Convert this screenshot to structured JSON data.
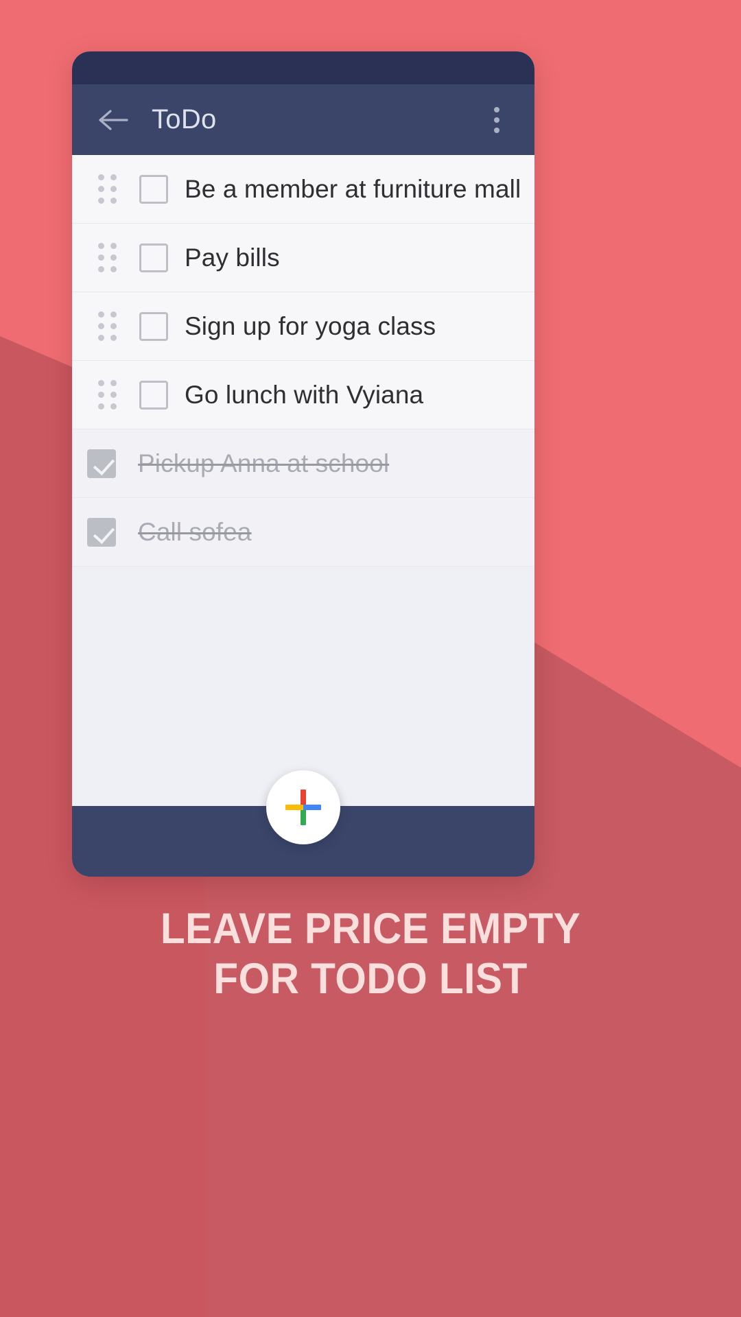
{
  "promo": {
    "background_color": "#ef6d72",
    "background_color_dark": "#c75a62",
    "caption_line1": "LEAVE PRICE EMPTY",
    "caption_line2": "FOR TODO LIST",
    "caption_color": "#fadfdd"
  },
  "app": {
    "statusbar_color": "#2b3155",
    "toolbar_color": "#3a4569",
    "toolbar": {
      "title": "ToDo",
      "back_icon": "arrow-left-icon",
      "overflow_icon": "more-vertical-icon"
    },
    "list": [
      {
        "label": "Be a member at furniture mall",
        "checked": false,
        "draggable": true
      },
      {
        "label": "Pay bills",
        "checked": false,
        "draggable": true
      },
      {
        "label": "Sign up for yoga class",
        "checked": false,
        "draggable": true
      },
      {
        "label": "Go lunch with Vyiana",
        "checked": false,
        "draggable": true
      },
      {
        "label": "Pickup Anna at school",
        "checked": true,
        "draggable": false
      },
      {
        "label": "Call sofea",
        "checked": true,
        "draggable": false
      }
    ],
    "fab": {
      "icon": "plus-icon",
      "colors": {
        "top": "#ea4335",
        "right": "#4285f4",
        "bottom": "#34a853",
        "left": "#fbbc05"
      }
    }
  }
}
